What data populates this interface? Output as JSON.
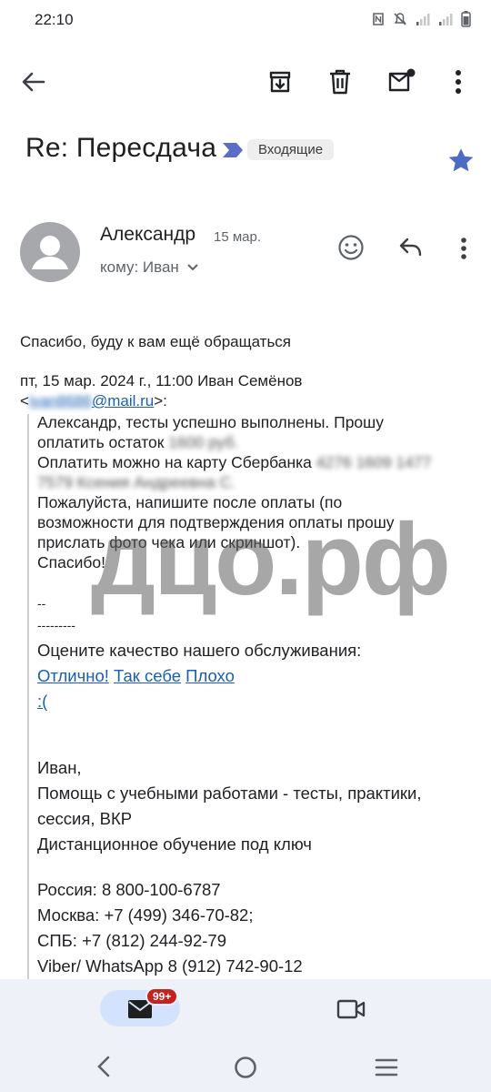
{
  "status": {
    "time": "22:10"
  },
  "toolbar": {
    "back": "back-arrow-icon",
    "archive": "archive-icon",
    "delete": "trash-icon",
    "mark_unread": "mark-unread-icon",
    "more": "more-vert-icon"
  },
  "email": {
    "subject": "Re: Пересдача",
    "label": "Входящие",
    "sender": "Александр",
    "date": "15 мар.",
    "to": "кому: Иван",
    "body_line": "Спасибо, буду к вам ещё обращаться",
    "quote_header_line1": "пт, 15 мар. 2024 г., 11:00 Иван Семёнов",
    "quote_header_open": "<",
    "quote_header_email_hidden": "ivan8686",
    "quote_header_email_domain": "@mail.ru",
    "quote_header_close": ">:",
    "quote": {
      "line1": "Александр, тесты успешно выполнены. Прошу",
      "line2": "оплатить остаток",
      "line2_hidden": "1600 руб.",
      "line3": "Оплатить можно на карту Сбербанка",
      "line3_hidden": "4276 1609 1477",
      "line4_hidden": "7579 Ксения Андреевна С.",
      "line5": "Пожалуйста, напишите после оплаты (по",
      "line6": "возможности для подтверждения оплаты прошу",
      "line7": "прислать фото чека или скриншот).",
      "line8": "Спасибо!",
      "sep1": "--",
      "sep2": "---------",
      "rate_prompt": "Оцените качество нашего обслуживания:",
      "rate_good": "Отлично!",
      "rate_ok": "Так себе",
      "rate_bad": "Плохо",
      "rate_sad": ":(",
      "sig_name": "Иван,",
      "sig_line1": "Помощь с учебными работами - тесты, практики,",
      "sig_line2": "сессия, ВКР",
      "sig_line3": "Дистанционное обучение под ключ",
      "phone_russia": "Россия: 8 800-100-6787",
      "phone_moscow": "Москва: +7 (499) 346-70-82;",
      "phone_spb": "СПБ: +7 (812) 244-92-79",
      "phone_viber": "Viber/ WhatsApp 8 (912) 742-90-12"
    }
  },
  "watermark": "дцо.рф",
  "bottom_nav": {
    "badge": "99+"
  }
}
